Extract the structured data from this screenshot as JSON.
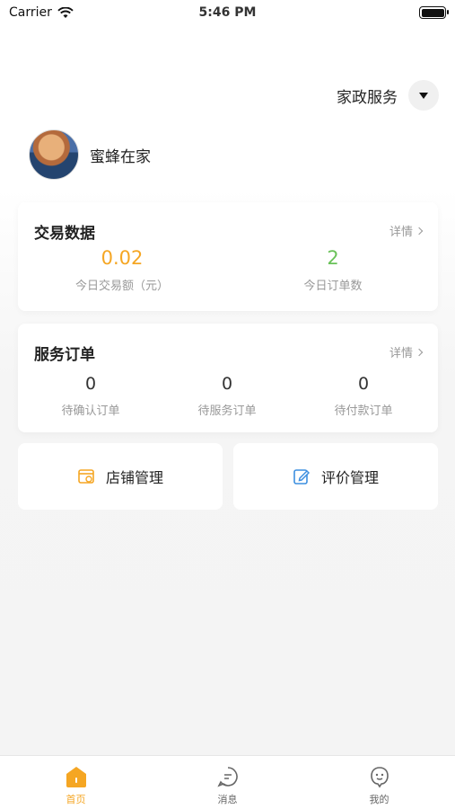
{
  "status_bar": {
    "carrier": "Carrier",
    "time": "5:46 PM"
  },
  "header": {
    "service_label": "家政服务"
  },
  "profile": {
    "name": "蜜蜂在家"
  },
  "transactions": {
    "title": "交易数据",
    "detail": "详情",
    "stats": [
      {
        "value": "0.02",
        "label": "今日交易额（元）",
        "color": "#f5a623"
      },
      {
        "value": "2",
        "label": "今日订单数",
        "color": "#6ac259"
      }
    ]
  },
  "service_orders": {
    "title": "服务订单",
    "detail": "详情",
    "stats": [
      {
        "value": "0",
        "label": "待确认订单"
      },
      {
        "value": "0",
        "label": "待服务订单"
      },
      {
        "value": "0",
        "label": "待付款订单"
      }
    ]
  },
  "actions": [
    {
      "label": "店铺管理",
      "icon": "store-icon",
      "color": "#f5a623"
    },
    {
      "label": "评价管理",
      "icon": "edit-icon",
      "color": "#3d8fe0"
    }
  ],
  "tabs": [
    {
      "label": "首页",
      "icon": "home-icon",
      "active": true
    },
    {
      "label": "消息",
      "icon": "message-icon",
      "active": false
    },
    {
      "label": "我的",
      "icon": "profile-icon",
      "active": false
    }
  ]
}
